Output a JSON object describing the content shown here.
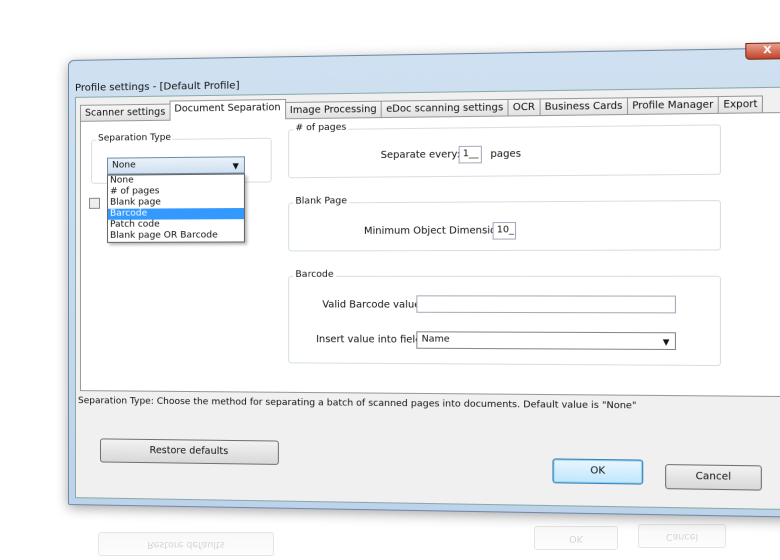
{
  "window": {
    "title": "Profile settings - [Default Profile]",
    "close": "X"
  },
  "tabs": [
    "Scanner settings",
    "Document Separation",
    "Image Processing",
    "eDoc scanning settings",
    "OCR",
    "Business Cards",
    "Profile Manager",
    "Export"
  ],
  "separation": {
    "label": "Separation Type",
    "selected": "None",
    "options": [
      "None",
      "# of pages",
      "Blank page",
      "Barcode",
      "Patch code",
      "Blank page OR Barcode"
    ],
    "highlighted": "Barcode"
  },
  "pages": {
    "label": "# of pages",
    "field_label": "Separate every:",
    "value": "1__",
    "unit": "pages"
  },
  "blank": {
    "label": "Blank Page",
    "field_label": "Minimum Object Dimension:",
    "value": "10_"
  },
  "barcode": {
    "label": "Barcode",
    "valid_label": "Valid Barcode value:",
    "valid_value": "",
    "insert_label": "Insert value into field:",
    "insert_value": "Name"
  },
  "help": "Separation Type: Choose the method for separating a batch of scanned pages into documents. Default value is \"None\"",
  "buttons": {
    "restore": "Restore defaults",
    "ok": "OK",
    "cancel": "Cancel"
  }
}
